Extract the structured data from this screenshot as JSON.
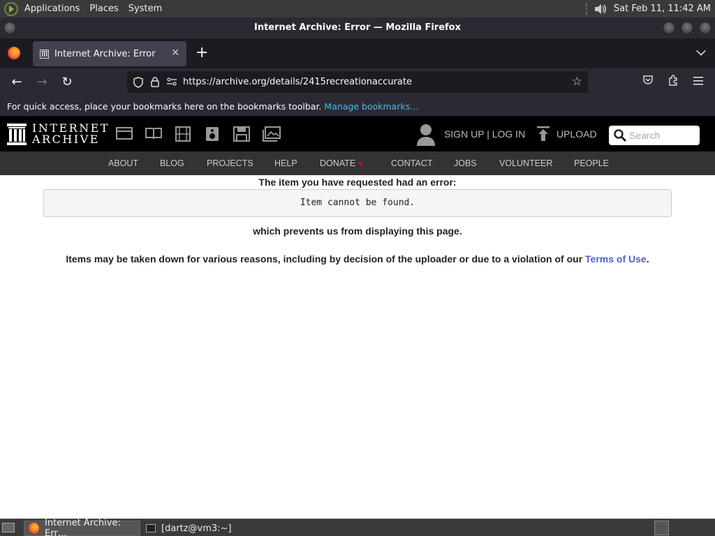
{
  "top_panel": {
    "menus": [
      "Applications",
      "Places",
      "System"
    ],
    "clock": "Sat Feb 11, 11:42 AM"
  },
  "window": {
    "title": "Internet Archive: Error — Mozilla Firefox"
  },
  "tabs": [
    {
      "label": "Internet Archive: Error"
    }
  ],
  "navbar": {
    "url": "https://archive.org/details/2415recreationaccurate"
  },
  "bookmarks_bar": {
    "message": "For quick access, place your bookmarks here on the bookmarks toolbar.",
    "link": "Manage bookmarks…"
  },
  "ia_header": {
    "logo_line1": "INTERNET",
    "logo_line2": "ARCHIVE",
    "signup_login": "SIGN UP | LOG IN",
    "upload": "UPLOAD",
    "search_placeholder": "Search"
  },
  "ia_nav": [
    "ABOUT",
    "BLOG",
    "PROJECTS",
    "HELP",
    "DONATE",
    "CONTACT",
    "JOBS",
    "VOLUNTEER",
    "PEOPLE"
  ],
  "main": {
    "error_heading": "The item you have requested had an error:",
    "error_message": "Item cannot be found.",
    "error_sub": "which prevents us from displaying this page.",
    "reason_text": "Items may be taken down for various reasons, including by decision of the uploader or due to a violation of our",
    "terms_link": "Terms of Use",
    "reason_end": "."
  },
  "taskbar": {
    "tasks": [
      "Internet Archive: Err…",
      "[dartz@vm3:~]"
    ]
  },
  "colors": {
    "link_blue": "#4b64c4",
    "bookmark_link": "#4cb9e8",
    "donate_heart": "#e4002b"
  }
}
